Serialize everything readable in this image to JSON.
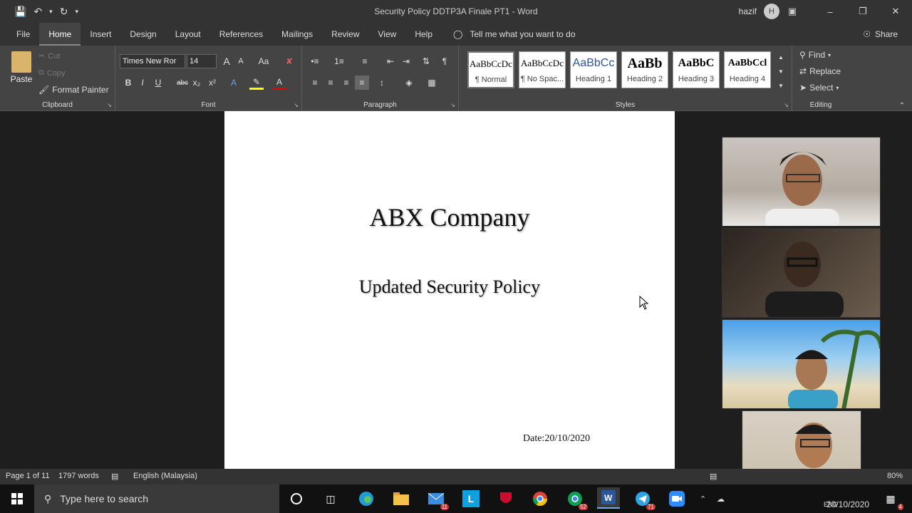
{
  "window": {
    "title": "Security Policy DDTP3A Finale PT1  -  Word",
    "user_name": "hazif",
    "user_initial": "H"
  },
  "tabs": [
    "File",
    "Home",
    "Insert",
    "Design",
    "Layout",
    "References",
    "Mailings",
    "Review",
    "View",
    "Help"
  ],
  "tell_me": "Tell me what you want to do",
  "share_label": "Share",
  "clipboard": {
    "paste": "Paste",
    "cut": "Cut",
    "copy": "Copy",
    "format_painter": "Format Painter",
    "label": "Clipboard"
  },
  "font": {
    "name": "Times New Ror",
    "size": "14",
    "label": "Font",
    "case": "Aa"
  },
  "paragraph": {
    "label": "Paragraph"
  },
  "styles": {
    "label": "Styles",
    "items": [
      {
        "preview": "AaBbCcDc",
        "name": "¶ Normal"
      },
      {
        "preview": "AaBbCcDc",
        "name": "¶ No Spac..."
      },
      {
        "preview": "AaBbCc",
        "name": "Heading 1"
      },
      {
        "preview": "AaBb",
        "name": "Heading 2"
      },
      {
        "preview": "AaBbC",
        "name": "Heading 3"
      },
      {
        "preview": "AaBbCcl",
        "name": "Heading 4"
      }
    ]
  },
  "editing": {
    "find": "Find",
    "replace": "Replace",
    "select": "Select",
    "label": "Editing"
  },
  "document": {
    "title": "ABX Company",
    "subtitle": "Updated Security Policy",
    "date": "Date:20/10/2020"
  },
  "status": {
    "page": "Page 1 of 11",
    "words": "1797 words",
    "language": "English (Malaysia)",
    "zoom": "80%"
  },
  "taskbar": {
    "search_placeholder": "Type here to search",
    "mail_badge": "11",
    "chrome_badge": "52",
    "telegram_badge": "71",
    "lang": "ENG",
    "date": "20/10/2020",
    "notifications": "4"
  },
  "colors": {
    "accent": "#2b579a",
    "ribbon_bg": "#444444",
    "titlebar_bg": "#333333"
  }
}
